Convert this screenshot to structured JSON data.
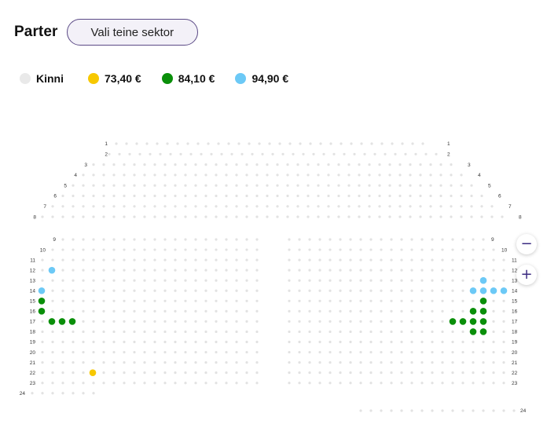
{
  "header": {
    "title": "Parter",
    "change_sector_label": "Vali teine sektor"
  },
  "legend": [
    {
      "label": "Kinni",
      "color": "#e9e9e9"
    },
    {
      "label": "73,40 €",
      "color": "#f7c800"
    },
    {
      "label": "84,10 €",
      "color": "#0a8f0a"
    },
    {
      "label": "94,90 €",
      "color": "#6cc9f6"
    }
  ],
  "zoom": {
    "out_icon": "minus-icon",
    "in_icon": "plus-icon"
  },
  "seatmap": {
    "row_labels_left": [
      "1",
      "2",
      "3",
      "4",
      "5",
      "6",
      "7",
      "8",
      "9",
      "10",
      "11",
      "12",
      "13",
      "14",
      "15",
      "16",
      "17",
      "18",
      "19",
      "20",
      "21",
      "22",
      "23",
      "24"
    ],
    "row_labels_right": [
      "1",
      "2",
      "3",
      "4",
      "5",
      "6",
      "7",
      "8",
      "9",
      "10",
      "11",
      "12",
      "13",
      "14",
      "15",
      "16",
      "17",
      "18",
      "19",
      "20",
      "21",
      "22",
      "23",
      "24"
    ],
    "available_seats": [
      {
        "row": "12",
        "side": "left",
        "price": "94,90 €"
      },
      {
        "row": "14",
        "side": "left",
        "price": "94,90 €"
      },
      {
        "row": "15",
        "side": "left",
        "price": "84,10 €"
      },
      {
        "row": "16",
        "side": "left",
        "price": "84,10 €"
      },
      {
        "row": "17",
        "side": "left",
        "price": "84,10 €"
      },
      {
        "row": "17",
        "side": "left",
        "price": "84,10 €"
      },
      {
        "row": "17",
        "side": "left",
        "price": "84,10 €"
      },
      {
        "row": "22",
        "side": "left",
        "price": "73,40 €"
      },
      {
        "row": "13",
        "side": "right",
        "price": "94,90 €"
      },
      {
        "row": "14",
        "side": "right",
        "price": "94,90 €"
      },
      {
        "row": "14",
        "side": "right",
        "price": "94,90 €"
      },
      {
        "row": "14",
        "side": "right",
        "price": "94,90 €"
      },
      {
        "row": "14",
        "side": "right",
        "price": "94,90 €"
      },
      {
        "row": "15",
        "side": "right",
        "price": "84,10 €"
      },
      {
        "row": "16",
        "side": "right",
        "price": "84,10 €"
      },
      {
        "row": "16",
        "side": "right",
        "price": "84,10 €"
      },
      {
        "row": "17",
        "side": "right",
        "price": "84,10 €"
      },
      {
        "row": "17",
        "side": "right",
        "price": "84,10 €"
      },
      {
        "row": "17",
        "side": "right",
        "price": "84,10 €"
      },
      {
        "row": "17",
        "side": "right",
        "price": "84,10 €"
      },
      {
        "row": "18",
        "side": "right",
        "price": "84,10 €"
      },
      {
        "row": "18",
        "side": "right",
        "price": "84,10 €"
      }
    ]
  }
}
